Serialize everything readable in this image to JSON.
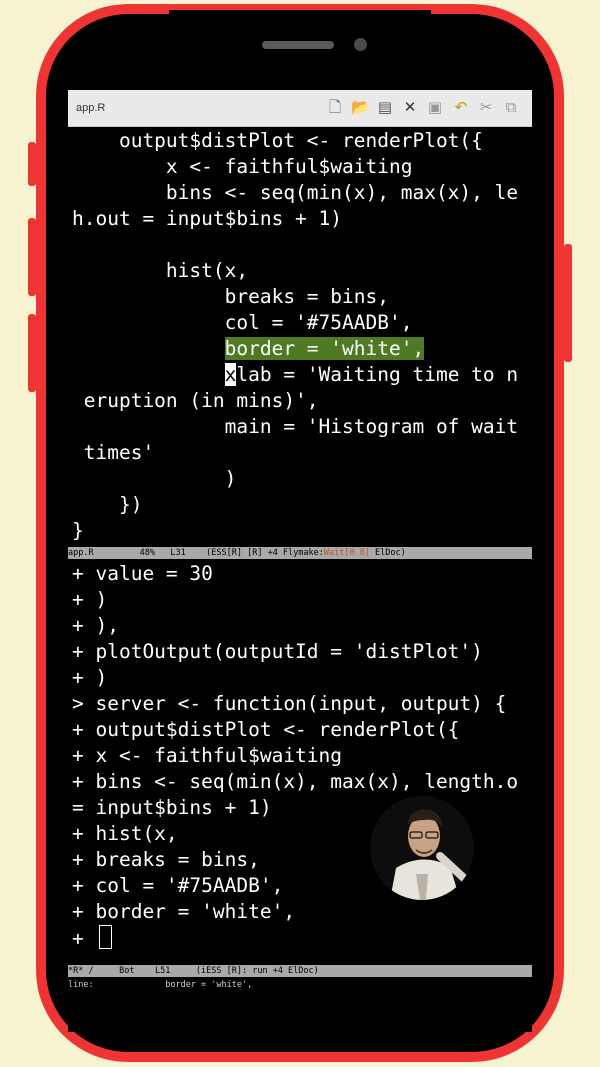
{
  "window": {
    "title": "app.R"
  },
  "toolbar": {
    "icons": [
      "new-file-icon",
      "open-folder-icon",
      "save-icon",
      "close-icon",
      "disk-icon",
      "undo-icon",
      "cut-icon",
      "copy-icon"
    ],
    "glyphs": [
      "🗋",
      "📂",
      "▤",
      "✕",
      "▣",
      "↶",
      "✂",
      "⧉"
    ]
  },
  "editor": {
    "lines": [
      "    output$distPlot <- renderPlot({",
      "        x <- faithful$waiting",
      "        bins <- seq(min(x), max(x), le",
      "h.out = input$bins + 1)",
      "",
      "        hist(x,",
      "             breaks = bins,",
      "             col = '#75AADB',",
      "             border = 'white',",
      "             xlab = 'Waiting time to n",
      " eruption (in mins)',",
      "             main = 'Histogram of wait",
      " times'",
      "             )",
      "    })",
      "}"
    ],
    "highlight_line": 8,
    "cursor_line": 9
  },
  "modeline_top": {
    "prefix": "app.R         48%   L31    (ESS[R] [R] +4 Flymake:",
    "wait": "Wait[0 0]",
    "suffix": " ElDoc)"
  },
  "repl": {
    "lines": [
      "+ value = 30",
      "+ )",
      "+ ),",
      "+ plotOutput(outputId = 'distPlot')",
      "+ )",
      "> server <- function(input, output) {",
      "+ output$distPlot <- renderPlot({",
      "+ x <- faithful$waiting",
      "+ bins <- seq(min(x), max(x), length.o",
      "= input$bins + 1)",
      "+ hist(x,",
      "+ breaks = bins,",
      "+ col = '#75AADB',",
      "+ border = 'white',",
      "+ "
    ]
  },
  "modeline_bottom": {
    "text": "*R* /     Bot    L51     (iESS [R]: run +4 ElDoc)"
  },
  "echo_area": {
    "text": "line:              border = 'white',"
  },
  "colors": {
    "frame": "#ef3434",
    "background": "#f7f3d1",
    "highlight": "#4f7a24"
  }
}
